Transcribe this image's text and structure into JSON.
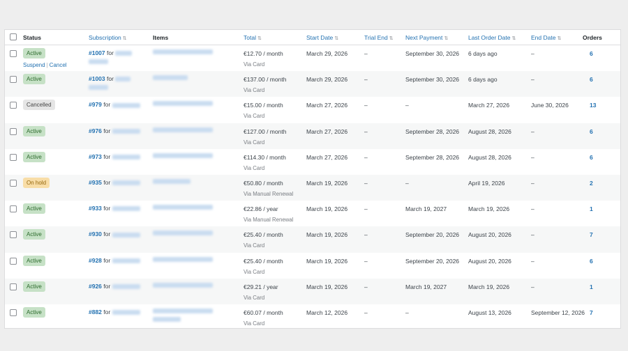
{
  "columns": {
    "status": "Status",
    "subscription": "Subscription",
    "items": "Items",
    "total": "Total",
    "start_date": "Start Date",
    "trial_end": "Trial End",
    "next_payment": "Next Payment",
    "last_order_date": "Last Order Date",
    "end_date": "End Date",
    "orders": "Orders"
  },
  "row_actions": {
    "suspend": "Suspend",
    "separator": "|",
    "cancel": "Cancel"
  },
  "for_text": "for",
  "colors": {
    "link": "#2271b1",
    "active_bg": "#c6e1c6",
    "cancelled_bg": "#e5e5e5",
    "onhold_bg": "#f8dda7"
  },
  "rows": [
    {
      "status": "Active",
      "status_type": "active",
      "id": "#1007",
      "total": "€12.70 / month",
      "via": "Via Card",
      "start": "March 29, 2026",
      "trial": "–",
      "next": "September 30, 2026",
      "last": "6 days ago",
      "end": "–",
      "orders": "6",
      "show_actions": true
    },
    {
      "status": "Active",
      "status_type": "active",
      "id": "#1003",
      "total": "€137.00 / month",
      "via": "Via Card",
      "start": "March 29, 2026",
      "trial": "–",
      "next": "September 30, 2026",
      "last": "6 days ago",
      "end": "–",
      "orders": "6"
    },
    {
      "status": "Cancelled",
      "status_type": "cancelled",
      "id": "#979",
      "total": "€15.00 / month",
      "via": "Via Card",
      "start": "March 27, 2026",
      "trial": "–",
      "next": "–",
      "last": "March 27, 2026",
      "end": "June 30, 2026",
      "orders": "13"
    },
    {
      "status": "Active",
      "status_type": "active",
      "id": "#976",
      "total": "€127.00 / month",
      "via": "Via Card",
      "start": "March 27, 2026",
      "trial": "–",
      "next": "September 28, 2026",
      "last": "August 28, 2026",
      "end": "–",
      "orders": "6"
    },
    {
      "status": "Active",
      "status_type": "active",
      "id": "#973",
      "total": "€114.30 / month",
      "via": "Via Card",
      "start": "March 27, 2026",
      "trial": "–",
      "next": "September 28, 2026",
      "last": "August 28, 2026",
      "end": "–",
      "orders": "6"
    },
    {
      "status": "On hold",
      "status_type": "onhold",
      "id": "#935",
      "total": "€50.80 / month",
      "via": "Via Manual Renewal",
      "start": "March 19, 2026",
      "trial": "–",
      "next": "–",
      "last": "April 19, 2026",
      "end": "–",
      "orders": "2"
    },
    {
      "status": "Active",
      "status_type": "active",
      "id": "#933",
      "total": "€22.86 / year",
      "via": "Via Manual Renewal",
      "start": "March 19, 2026",
      "trial": "–",
      "next": "March 19, 2027",
      "last": "March 19, 2026",
      "end": "–",
      "orders": "1"
    },
    {
      "status": "Active",
      "status_type": "active",
      "id": "#930",
      "total": "€25.40 / month",
      "via": "Via Card",
      "start": "March 19, 2026",
      "trial": "–",
      "next": "September 20, 2026",
      "last": "August 20, 2026",
      "end": "–",
      "orders": "7"
    },
    {
      "status": "Active",
      "status_type": "active",
      "id": "#928",
      "total": "€25.40 / month",
      "via": "Via Card",
      "start": "March 19, 2026",
      "trial": "–",
      "next": "September 20, 2026",
      "last": "August 20, 2026",
      "end": "–",
      "orders": "6"
    },
    {
      "status": "Active",
      "status_type": "active",
      "id": "#926",
      "total": "€29.21 / year",
      "via": "Via Card",
      "start": "March 19, 2026",
      "trial": "–",
      "next": "March 19, 2027",
      "last": "March 19, 2026",
      "end": "–",
      "orders": "1"
    },
    {
      "status": "Active",
      "status_type": "active",
      "id": "#882",
      "total": "€60.07 / month",
      "via": "Via Card",
      "start": "March 12, 2026",
      "trial": "–",
      "next": "–",
      "last": "August 13, 2026",
      "end": "September 12, 2026",
      "orders": "7"
    }
  ]
}
